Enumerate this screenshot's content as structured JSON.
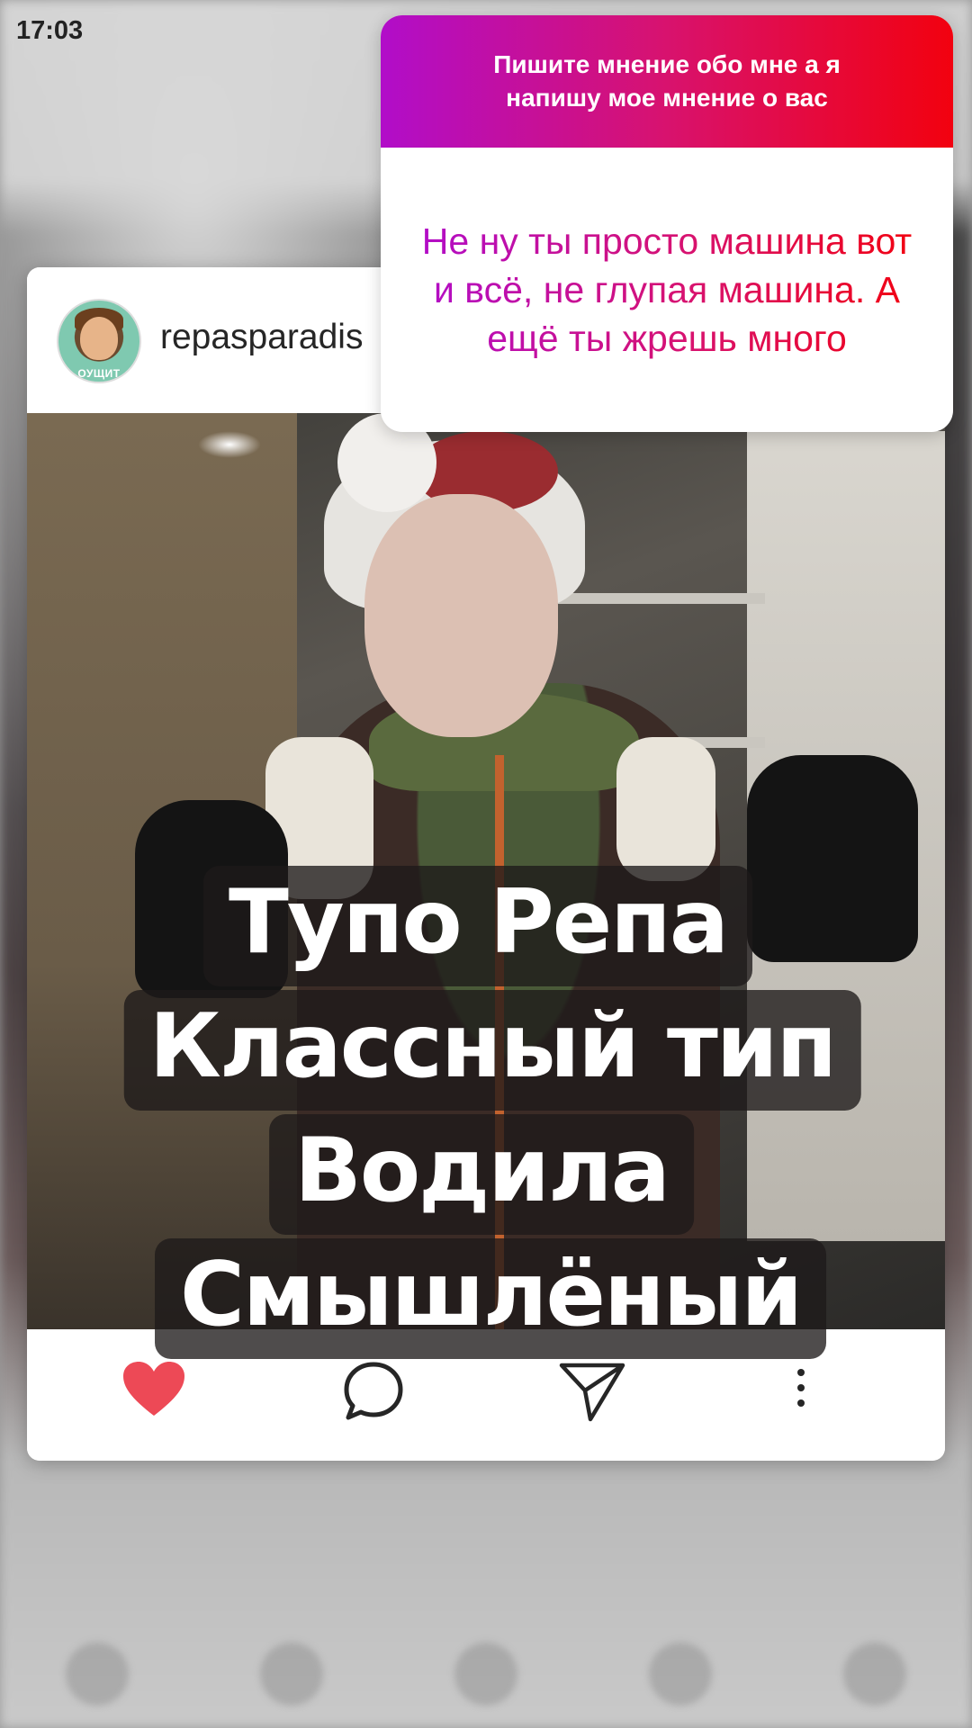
{
  "status_bar": {
    "time": "17:03"
  },
  "post": {
    "username": "repasparadis",
    "avatar_caption": "ОУЩИТ",
    "overlay_lines": [
      "Тупо Репа",
      "Классный тип",
      "Водила",
      "Смышлёный"
    ],
    "actions": {
      "like_icon": "heart-filled",
      "comment_icon": "speech-bubble",
      "share_icon": "paper-plane",
      "more_icon": "vertical-dots",
      "like_color": "#ed4956"
    }
  },
  "question_sticker": {
    "prompt": "Пишите мнение обо мне а я напишу мое мнение о вас",
    "answer": "Не ну ты просто машина вот и всё, не глупая машина. А ещё ты жрешь много",
    "gradient_colors": [
      "#b10dc9",
      "#d8126e",
      "#f2010f"
    ]
  }
}
